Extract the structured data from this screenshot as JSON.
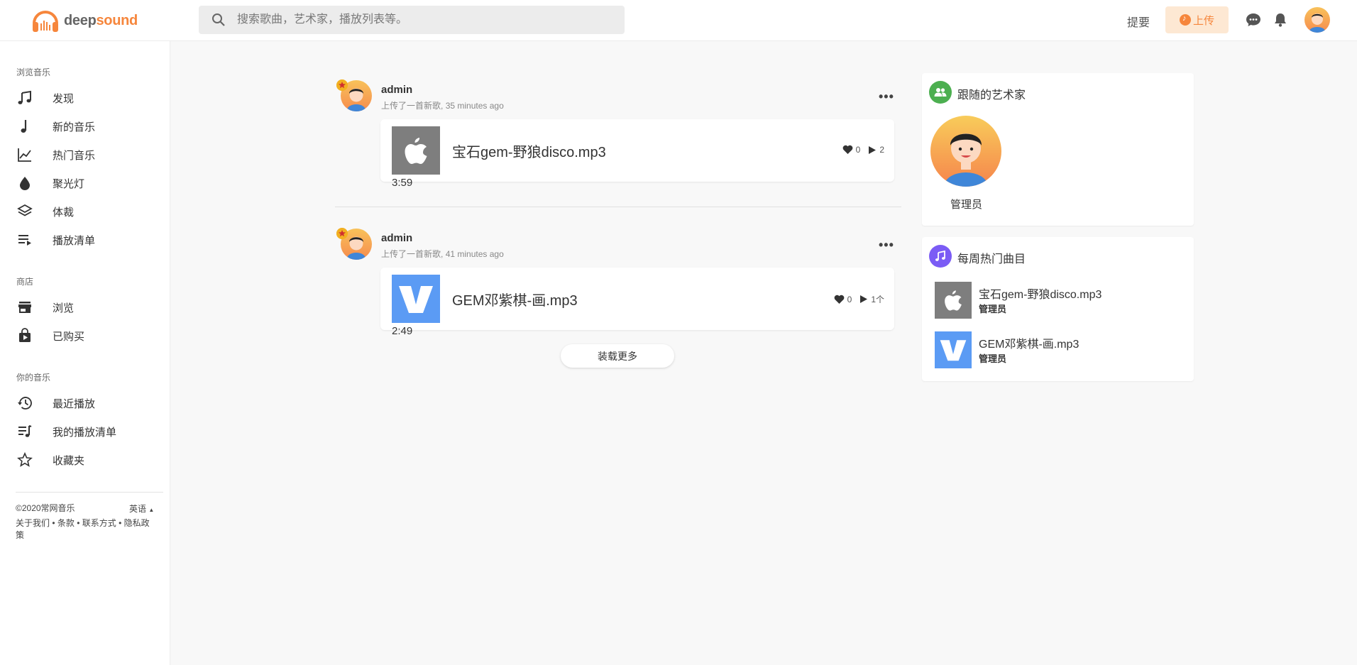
{
  "header": {
    "logo_text_a": "deep",
    "logo_text_b": "sound",
    "search_placeholder": "搜索歌曲，艺术家，播放列表等。",
    "link": "提要",
    "upload_label": "上传"
  },
  "sidebar": {
    "sections": [
      {
        "title": "浏览音乐",
        "items": [
          {
            "label": "发现",
            "icon": "music-note-double-icon"
          },
          {
            "label": "新的音乐",
            "icon": "music-note-icon"
          },
          {
            "label": "热门音乐",
            "icon": "trending-chart-icon"
          },
          {
            "label": "聚光灯",
            "icon": "drop-icon"
          },
          {
            "label": "体裁",
            "icon": "layers-icon"
          },
          {
            "label": "播放清单",
            "icon": "playlist-icon"
          }
        ]
      },
      {
        "title": "商店",
        "items": [
          {
            "label": "浏览",
            "icon": "store-icon"
          },
          {
            "label": "已购买",
            "icon": "shopping-bag-icon"
          }
        ]
      },
      {
        "title": "你的音乐",
        "items": [
          {
            "label": "最近播放",
            "icon": "history-icon"
          },
          {
            "label": "我的播放清单",
            "icon": "my-playlist-icon"
          },
          {
            "label": "收藏夹",
            "icon": "star-icon"
          }
        ]
      }
    ],
    "footer": {
      "copyright": "©2020常网音乐",
      "language": "英语",
      "links_line1": "关于我们 • 条款 • 联系方式 • 隐私政",
      "links_line2": "策"
    }
  },
  "feed": {
    "posts": [
      {
        "user": "admin",
        "subtitle_a": "上传了一首新歌,",
        "subtitle_b": "35 minutes ago",
        "track": {
          "title": "宝石gem-野狼disco.mp3",
          "likes": "0",
          "plays": "2",
          "duration": "3:59",
          "thumb": "apple-logo"
        }
      },
      {
        "user": "admin",
        "subtitle_a": "上传了一首新歌,",
        "subtitle_b": "41 minutes ago",
        "track": {
          "title": "GEM邓紫棋-画.mp3",
          "likes": "0",
          "plays": "1个",
          "duration": "2:49",
          "thumb": "v-logo"
        }
      }
    ],
    "more_icon": "•••",
    "load_more": "装载更多"
  },
  "right": {
    "following": {
      "title": "跟随的艺术家",
      "artist": "管理员"
    },
    "weekly": {
      "title": "每周热门曲目",
      "items": [
        {
          "title": "宝石gem-野狼disco.mp3",
          "artist": "管理员",
          "thumb": "apple-logo"
        },
        {
          "title": "GEM邓紫棋-画.mp3",
          "artist": "管理员",
          "thumb": "v-logo"
        }
      ]
    }
  },
  "colors": {
    "accent": "#f6863c",
    "green": "#4caf50",
    "purple": "#7b5cf5"
  }
}
